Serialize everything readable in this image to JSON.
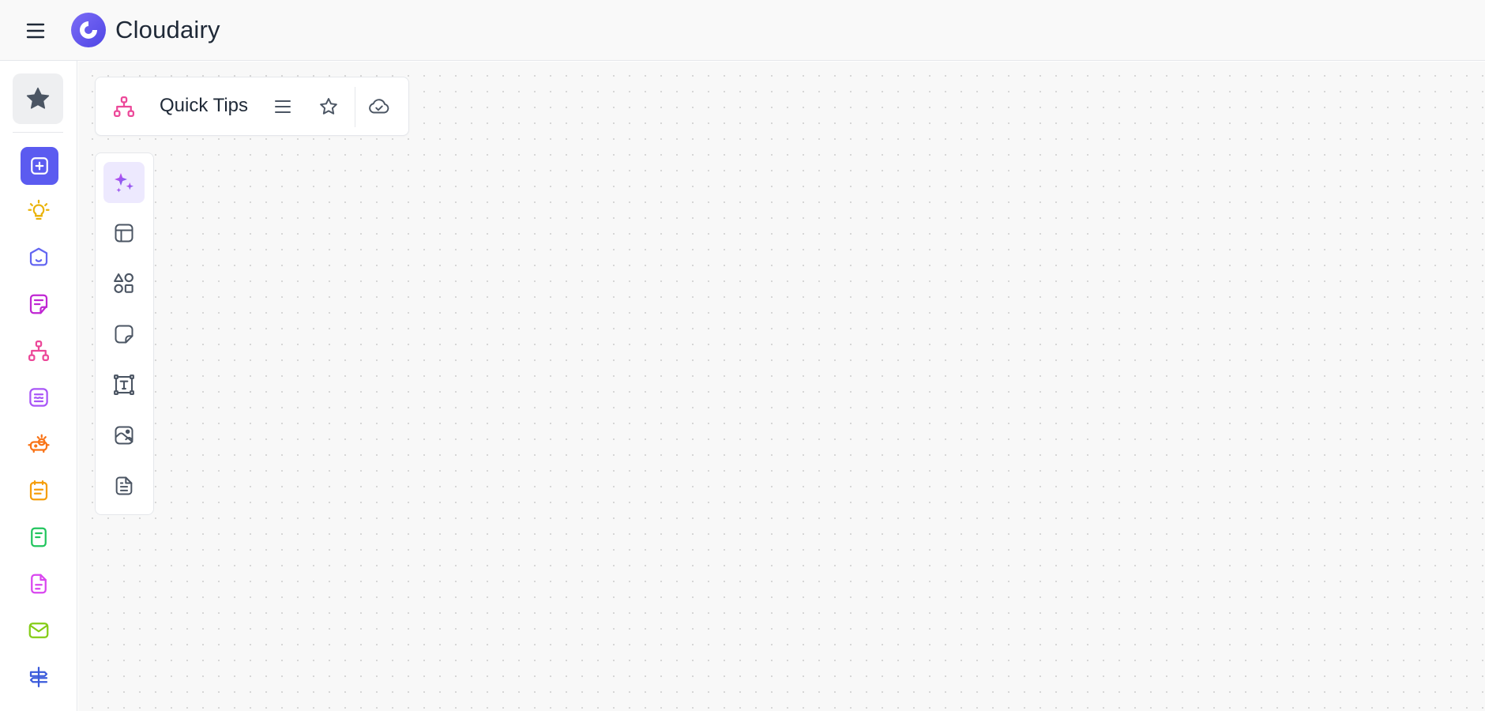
{
  "app": {
    "brand_name": "Cloudairy",
    "brand_color": "#6366f1"
  },
  "topbar": {
    "menu_icon": "hamburger-menu-icon",
    "logo_icon": "cloudairy-logo-icon"
  },
  "sidebar": {
    "favorites_icon": "star-filled-icon",
    "add_icon": "plus-square-icon",
    "add_color": "#5b5bf0",
    "items": [
      {
        "icon": "lightbulb-icon",
        "color": "#eab308"
      },
      {
        "icon": "home-icon",
        "color": "#6366f1"
      },
      {
        "icon": "note-icon",
        "color": "#c026d3"
      },
      {
        "icon": "sitemap-icon",
        "color": "#ec4899"
      },
      {
        "icon": "document-lines-icon",
        "color": "#a855f7"
      },
      {
        "icon": "presentation-bot-icon",
        "color": "#f97316"
      },
      {
        "icon": "calendar-icon",
        "color": "#f59e0b"
      },
      {
        "icon": "notepad-icon",
        "color": "#22c55e"
      },
      {
        "icon": "file-text-icon",
        "color": "#d946ef"
      },
      {
        "icon": "mail-icon",
        "color": "#84cc16"
      },
      {
        "icon": "signpost-icon",
        "color": "#3b5bdb"
      }
    ]
  },
  "document": {
    "type_icon": "sitemap-icon",
    "type_color": "#ec4899",
    "title": "Quick Tips",
    "menu_icon": "list-icon",
    "favorite_icon": "star-outline-icon",
    "sync_icon": "cloud-check-icon"
  },
  "tools": [
    {
      "icon": "sparkles-ai-icon",
      "active": true
    },
    {
      "icon": "layout-template-icon",
      "active": false
    },
    {
      "icon": "shapes-icon",
      "active": false
    },
    {
      "icon": "sticky-note-icon",
      "active": false
    },
    {
      "icon": "text-box-icon",
      "active": false
    },
    {
      "icon": "image-icon",
      "active": false
    },
    {
      "icon": "document-icon",
      "active": false
    }
  ]
}
